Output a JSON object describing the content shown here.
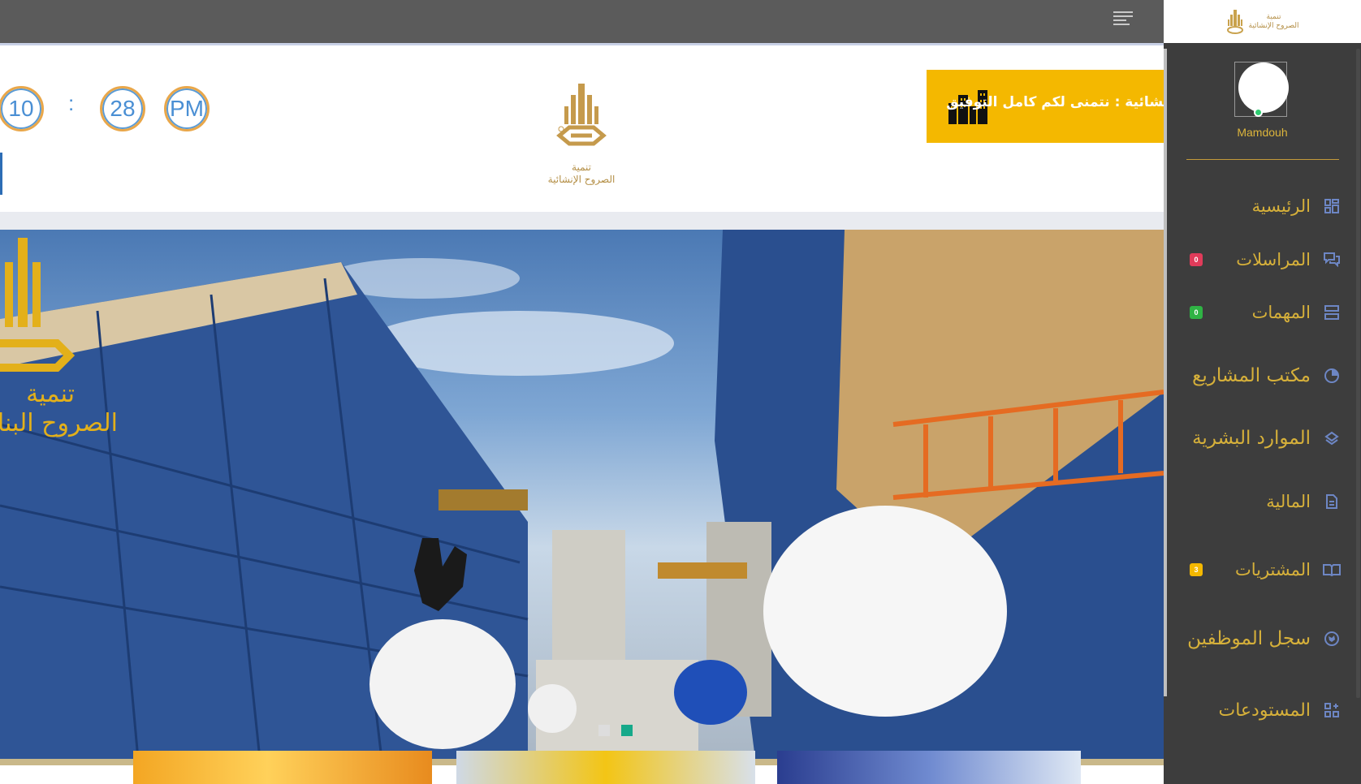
{
  "topbar": {
    "menu_icon": "hamburger-icon"
  },
  "sidebar": {
    "logo_text": [
      "تنمية",
      "الصروح الإنشائية"
    ],
    "username": "Mamdouh",
    "items": [
      {
        "label": "الرئيسية",
        "icon": "dashboard-grid-icon",
        "badge": null
      },
      {
        "label": "المراسلات",
        "icon": "chat-bubbles-icon",
        "badge": "0",
        "badge_color": "#e03b5a"
      },
      {
        "label": "المهمات",
        "icon": "tasks-list-icon",
        "badge": "0",
        "badge_color": "#2fb344"
      },
      {
        "label": "مكتب المشاريع",
        "icon": "pie-chart-icon",
        "badge": null
      },
      {
        "label": "الموارد البشرية",
        "icon": "layers-icon",
        "badge": null
      },
      {
        "label": "المالية",
        "icon": "document-icon",
        "badge": null
      },
      {
        "label": "المشتريات",
        "icon": "open-book-icon",
        "badge": "3",
        "badge_color": "#f4b800"
      },
      {
        "label": "سجل الموظفين",
        "icon": "globe-icon",
        "badge": null
      },
      {
        "label": "المستودعات",
        "icon": "apps-icon",
        "badge": null
      }
    ]
  },
  "header": {
    "clock": {
      "hour": "10",
      "separator": ":",
      "minute": "28",
      "ampm": "PM"
    },
    "logo_text": [
      "تنمية",
      "الصروح الإنشائية"
    ],
    "marquee": "نشائية : نتمنى لكم كامل التوفيق",
    "marquee_icon": "buildings-icon"
  },
  "hero": {
    "watermark_text": [
      "تنمية",
      "الصروح البنائية"
    ],
    "dots": [
      "inactive",
      "active"
    ]
  },
  "colors": {
    "topbar": "#5b5b5b",
    "sidebar": "#3d3d3d",
    "gold": "#d6b03a",
    "marquee": "#f4b800",
    "active_dot": "#16a98a"
  }
}
